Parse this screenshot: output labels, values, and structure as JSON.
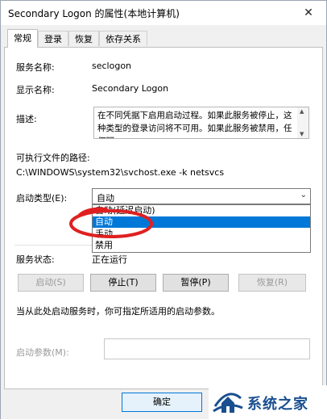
{
  "window": {
    "title": "Secondary Logon 的属性(本地计算机)",
    "close_glyph": "✕"
  },
  "tabs": [
    {
      "label": "常规",
      "active": true
    },
    {
      "label": "登录",
      "active": false
    },
    {
      "label": "恢复",
      "active": false
    },
    {
      "label": "依存关系",
      "active": false
    }
  ],
  "general": {
    "service_name_label": "服务名称:",
    "service_name": "seclogon",
    "display_name_label": "显示名称:",
    "display_name": "Secondary Logon",
    "description_label": "描述:",
    "description": "在不同凭据下启用启动过程。如果此服务被停止，这种类型的登录访问将不可用。如果此服务被禁用，任何明",
    "exe_path_label": "可执行文件的路径:",
    "exe_path": "C:\\WINDOWS\\system32\\svchost.exe -k netsvcs",
    "startup_type_label": "启动类型(E):",
    "startup_type_value": "自动",
    "startup_options": [
      "自动(延迟启动)",
      "自动",
      "手动",
      "禁用"
    ],
    "startup_selected": "自动",
    "status_label": "服务状态:",
    "status_value": "正在运行",
    "buttons": {
      "start": "启动(S)",
      "stop": "停止(T)",
      "pause": "暂停(P)",
      "resume": "恢复(R)"
    },
    "hint": "当从此处启动服务时，你可指定所适用的启动参数。",
    "param_label": "启动参数(M):",
    "param_value": ""
  },
  "footer": {
    "ok": "确定"
  },
  "watermark": {
    "text": "系统之家"
  },
  "colors": {
    "selection": "#0078d7",
    "annotation": "#e02020",
    "watermark": "#1a4f8f"
  }
}
